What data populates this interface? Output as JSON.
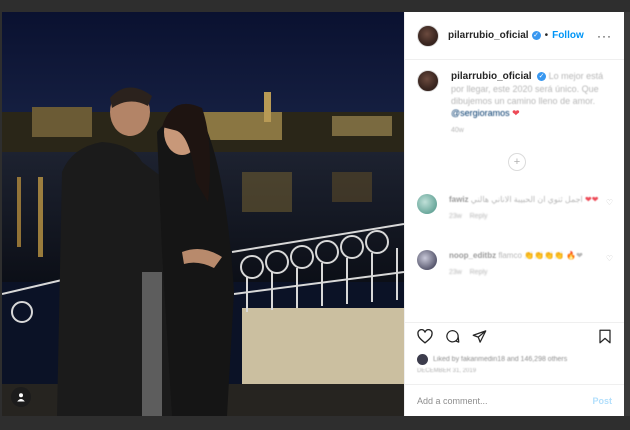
{
  "post": {
    "username": "pilarrubio_oficial",
    "verified_mark": "✓",
    "dot": "•",
    "follow_label": "Follow",
    "more_label": "···"
  },
  "caption": {
    "username": "pilarrubio_oficial",
    "text": "Lo mejor está por llegar, este 2020 será único. Que dibujemos un camino lleno de amor.",
    "mention": "@sergioramos",
    "heart": "❤",
    "time": "40w"
  },
  "load_more": "+",
  "comments": [
    {
      "username": "fawiz",
      "text": "اجمل ثنوي ان الحبيبة الاناني هالني",
      "hearts": "❤❤",
      "time": "23w",
      "reply": "Reply"
    },
    {
      "username": "noop_editbz",
      "text": "flamco",
      "emojis": "👏👏👏👏",
      "hearts": "🔥❤",
      "time": "23w",
      "reply": "Reply"
    }
  ],
  "likes_text": "Liked by fakanmedin18 and 146,298 others",
  "date_text": "DECEMBER 31, 2019",
  "add_comment": {
    "placeholder": "Add a comment...",
    "post_label": "Post"
  },
  "icons": {
    "user_tag": "user-tag-icon",
    "heart": "heart-icon",
    "comment": "comment-icon",
    "share": "share-icon",
    "save": "save-icon"
  }
}
